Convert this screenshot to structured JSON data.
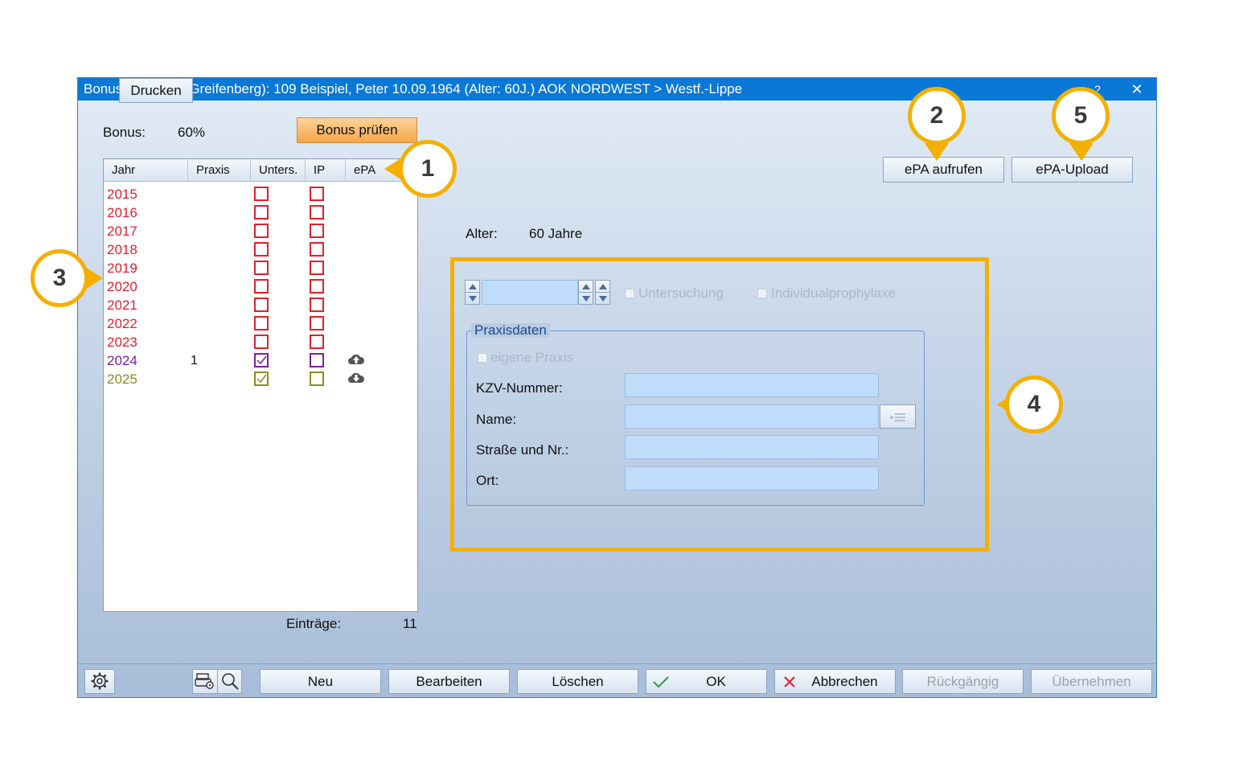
{
  "window": {
    "title": "Bonusheft für (W.Greifenberg): 109  Beispiel, Peter 10.09.1964  (Alter: 60J.)  AOK NORDWEST > Westf.-Lippe",
    "help_glyph": "?",
    "close_glyph": "✕"
  },
  "bonus": {
    "label": "Bonus:",
    "value": "60%",
    "check_button": "Bonus prüfen"
  },
  "list": {
    "headers": [
      "Jahr",
      "Praxis",
      "Unters.",
      "IP",
      "ePA"
    ],
    "rows": [
      {
        "year": "2015",
        "praxis": "",
        "unters": "unchecked",
        "ip": "unchecked",
        "epa": "",
        "color": "#e0202e"
      },
      {
        "year": "2016",
        "praxis": "",
        "unters": "unchecked",
        "ip": "unchecked",
        "epa": "",
        "color": "#e0202e"
      },
      {
        "year": "2017",
        "praxis": "",
        "unters": "unchecked",
        "ip": "unchecked",
        "epa": "",
        "color": "#e0202e"
      },
      {
        "year": "2018",
        "praxis": "",
        "unters": "unchecked",
        "ip": "unchecked",
        "epa": "",
        "color": "#e0202e"
      },
      {
        "year": "2019",
        "praxis": "",
        "unters": "unchecked",
        "ip": "unchecked",
        "epa": "",
        "color": "#e0202e"
      },
      {
        "year": "2020",
        "praxis": "",
        "unters": "unchecked",
        "ip": "unchecked",
        "epa": "",
        "color": "#e0202e"
      },
      {
        "year": "2021",
        "praxis": "",
        "unters": "unchecked",
        "ip": "unchecked",
        "epa": "",
        "color": "#e0202e"
      },
      {
        "year": "2022",
        "praxis": "",
        "unters": "unchecked",
        "ip": "unchecked",
        "epa": "",
        "color": "#e0202e"
      },
      {
        "year": "2023",
        "praxis": "",
        "unters": "unchecked",
        "ip": "unchecked",
        "epa": "",
        "color": "#e0202e"
      },
      {
        "year": "2024",
        "praxis": "1",
        "unters": "checked",
        "ip": "unchecked",
        "epa": "cloud-upload-icon",
        "color": "#7a1fa0"
      },
      {
        "year": "2025",
        "praxis": "",
        "unters": "checked",
        "ip": "unchecked",
        "epa": "cloud-download-icon",
        "color": "#8c8c20"
      }
    ],
    "entries_label": "Einträge:",
    "entries_value": "11"
  },
  "epa_buttons": {
    "open": "ePA aufrufen",
    "upload": "ePA-Upload"
  },
  "age": {
    "label": "Alter:",
    "value": "60 Jahre"
  },
  "detail": {
    "year_value": "",
    "untersuchung": "Untersuchung",
    "individualprophylaxe": "Individualprophylaxe",
    "praxisdaten": {
      "title": "Praxisdaten",
      "eigene_praxis": "eigene Praxis",
      "kzv_label": "KZV-Nummer:",
      "name_label": "Name:",
      "strasse_label": "Straße und Nr.:",
      "ort_label": "Ort:",
      "kzv_value": "",
      "name_value": "",
      "strasse_value": "",
      "ort_value": ""
    }
  },
  "footer": {
    "settings_icon": "gear-icon",
    "print": "Drucken",
    "printer_settings_icon": "printer-settings-icon",
    "preview_icon": "magnifier-icon",
    "new": "Neu",
    "edit": "Bearbeiten",
    "delete": "Löschen",
    "ok": "OK",
    "cancel": "Abbrechen",
    "undo": "Rückgängig",
    "apply": "Übernehmen"
  },
  "markers": [
    "1",
    "2",
    "3",
    "4",
    "5"
  ],
  "colors": {
    "accent": "#f4b000",
    "titlebar": "#0a78d7",
    "past_year": "#e0202e",
    "year_2024": "#7a1fa0",
    "year_2025": "#8c8c20"
  }
}
